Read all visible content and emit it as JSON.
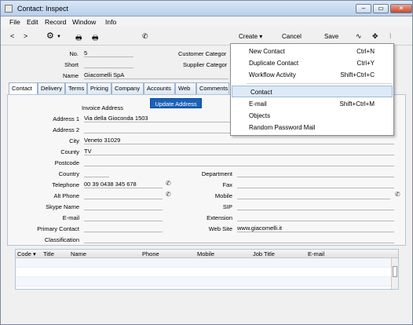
{
  "window": {
    "title": "Contact: Inspect"
  },
  "menubar": [
    "File",
    "Edit",
    "Record",
    "Window",
    "Info"
  ],
  "toolbar": {
    "create": "Create",
    "cancel": "Cancel",
    "save": "Save"
  },
  "header": {
    "no_label": "No.",
    "no_value": "5",
    "short_label": "Short",
    "short_value": "",
    "name_label": "Name",
    "name_value": "Giacomelli SpA",
    "customer_category_label": "Customer Categor",
    "supplier_category_label": "Supplier Categor"
  },
  "tabs": [
    "Contact",
    "Delivery",
    "Terms",
    "Pricing",
    "Company",
    "Accounts",
    "Web",
    "Comments"
  ],
  "contact": {
    "invoice_address_label": "Invoice Address",
    "update_address_button": "Update Address",
    "address1_label": "Address 1",
    "address1_value": "Via della Gioconda 1503",
    "address2_label": "Address 2",
    "address2_value": "",
    "city_label": "City",
    "city_value": "Veneto 31029",
    "county_label": "County",
    "county_value": "TV",
    "postcode_label": "Postcode",
    "postcode_value": "",
    "country_label": "Country",
    "country_value": "",
    "telephone_label": "Telephone",
    "telephone_value": "00 39 0438 345 678",
    "alt_phone_label": "Alt Phone",
    "alt_phone_value": "",
    "skype_label": "Skype Name",
    "skype_value": "",
    "email_label": "E-mail",
    "email_value": "",
    "primary_contact_label": "Primary Contact",
    "primary_contact_value": "",
    "classification_label": "Classification",
    "classification_value": "",
    "department_label": "Department",
    "department_value": "",
    "fax_label": "Fax",
    "fax_value": "",
    "mobile_label": "Mobile",
    "mobile_value": "",
    "sip_label": "SIP",
    "sip_value": "",
    "extension_label": "Extension",
    "extension_value": "",
    "website_label": "Web Site",
    "website_value": "www.giacomelli.it"
  },
  "grid": {
    "columns": [
      "Code",
      "Title",
      "Name",
      "Phone",
      "Mobile",
      "Job Title",
      "E-mail"
    ]
  },
  "create_menu": {
    "items": [
      {
        "label": "New Contact",
        "shortcut": "Ctrl+N"
      },
      {
        "label": "Duplicate Contact",
        "shortcut": "Ctrl+Y"
      },
      {
        "label": "Workflow Activity",
        "shortcut": "Shift+Ctrl+C"
      },
      {
        "label": "Contact",
        "shortcut": ""
      },
      {
        "label": "E-mail",
        "shortcut": "Shift+Ctrl+M"
      },
      {
        "label": "Objects",
        "shortcut": ""
      },
      {
        "label": "Random Password Mail",
        "shortcut": ""
      }
    ]
  }
}
